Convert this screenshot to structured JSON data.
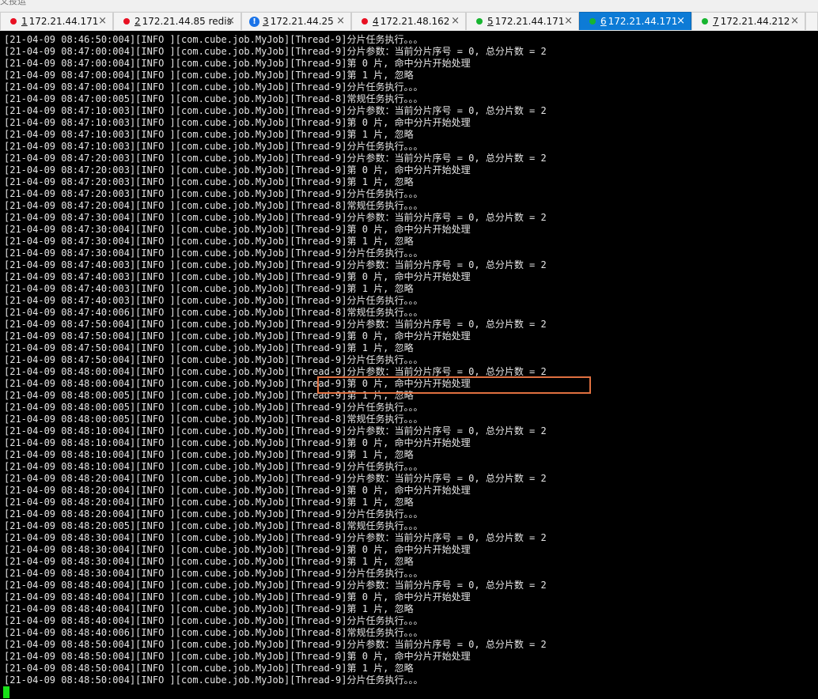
{
  "top_strip": {
    "text": "文投运"
  },
  "tabs": [
    {
      "num": "1",
      "title": "172.21.44.171",
      "status": "red",
      "close": "×"
    },
    {
      "num": "2",
      "title": "172.21.44.85 redis",
      "status": "red",
      "close": "×"
    },
    {
      "num": "3",
      "title": "172.21.44.25",
      "status": "warn",
      "close": "×"
    },
    {
      "num": "4",
      "title": "172.21.48.162",
      "status": "red",
      "close": "×"
    },
    {
      "num": "5",
      "title": "172.21.44.171",
      "status": "green",
      "close": "×"
    },
    {
      "num": "6",
      "title": "172.21.44.171",
      "status": "green",
      "close": "×",
      "active": true
    },
    {
      "num": "7",
      "title": "172.21.44.212",
      "status": "green",
      "close": "×"
    }
  ],
  "log_lines": [
    "[21-04-09 08:46:50:004][INFO ][com.cube.job.MyJob][Thread-9]分片任务执行。。。",
    "[21-04-09 08:47:00:004][INFO ][com.cube.job.MyJob][Thread-9]分片参数：当前分片序号 = 0, 总分片数 = 2",
    "[21-04-09 08:47:00:004][INFO ][com.cube.job.MyJob][Thread-9]第 0 片, 命中分片开始处理",
    "[21-04-09 08:47:00:004][INFO ][com.cube.job.MyJob][Thread-9]第 1 片, 忽略",
    "[21-04-09 08:47:00:004][INFO ][com.cube.job.MyJob][Thread-9]分片任务执行。。。",
    "[21-04-09 08:47:00:005][INFO ][com.cube.job.MyJob][Thread-8]常规任务执行。。。",
    "[21-04-09 08:47:10:003][INFO ][com.cube.job.MyJob][Thread-9]分片参数：当前分片序号 = 0, 总分片数 = 2",
    "[21-04-09 08:47:10:003][INFO ][com.cube.job.MyJob][Thread-9]第 0 片, 命中分片开始处理",
    "[21-04-09 08:47:10:003][INFO ][com.cube.job.MyJob][Thread-9]第 1 片, 忽略",
    "[21-04-09 08:47:10:003][INFO ][com.cube.job.MyJob][Thread-9]分片任务执行。。。",
    "[21-04-09 08:47:20:003][INFO ][com.cube.job.MyJob][Thread-9]分片参数：当前分片序号 = 0, 总分片数 = 2",
    "[21-04-09 08:47:20:003][INFO ][com.cube.job.MyJob][Thread-9]第 0 片, 命中分片开始处理",
    "[21-04-09 08:47:20:003][INFO ][com.cube.job.MyJob][Thread-9]第 1 片, 忽略",
    "[21-04-09 08:47:20:003][INFO ][com.cube.job.MyJob][Thread-9]分片任务执行。。。",
    "[21-04-09 08:47:20:004][INFO ][com.cube.job.MyJob][Thread-8]常规任务执行。。。",
    "[21-04-09 08:47:30:004][INFO ][com.cube.job.MyJob][Thread-9]分片参数：当前分片序号 = 0, 总分片数 = 2",
    "[21-04-09 08:47:30:004][INFO ][com.cube.job.MyJob][Thread-9]第 0 片, 命中分片开始处理",
    "[21-04-09 08:47:30:004][INFO ][com.cube.job.MyJob][Thread-9]第 1 片, 忽略",
    "[21-04-09 08:47:30:004][INFO ][com.cube.job.MyJob][Thread-9]分片任务执行。。。",
    "[21-04-09 08:47:40:003][INFO ][com.cube.job.MyJob][Thread-9]分片参数：当前分片序号 = 0, 总分片数 = 2",
    "[21-04-09 08:47:40:003][INFO ][com.cube.job.MyJob][Thread-9]第 0 片, 命中分片开始处理",
    "[21-04-09 08:47:40:003][INFO ][com.cube.job.MyJob][Thread-9]第 1 片, 忽略",
    "[21-04-09 08:47:40:003][INFO ][com.cube.job.MyJob][Thread-9]分片任务执行。。。",
    "[21-04-09 08:47:40:006][INFO ][com.cube.job.MyJob][Thread-8]常规任务执行。。。",
    "[21-04-09 08:47:50:004][INFO ][com.cube.job.MyJob][Thread-9]分片参数：当前分片序号 = 0, 总分片数 = 2",
    "[21-04-09 08:47:50:004][INFO ][com.cube.job.MyJob][Thread-9]第 0 片, 命中分片开始处理",
    "[21-04-09 08:47:50:004][INFO ][com.cube.job.MyJob][Thread-9]第 1 片, 忽略",
    "[21-04-09 08:47:50:004][INFO ][com.cube.job.MyJob][Thread-9]分片任务执行。。。",
    "[21-04-09 08:48:00:004][INFO ][com.cube.job.MyJob][Thread-9]分片参数：当前分片序号 = 0, 总分片数 = 2",
    "[21-04-09 08:48:00:004][INFO ][com.cube.job.MyJob][Thread-9]第 0 片, 命中分片开始处理",
    "[21-04-09 08:48:00:005][INFO ][com.cube.job.MyJob][Thread-9]第 1 片, 忽略",
    "[21-04-09 08:48:00:005][INFO ][com.cube.job.MyJob][Thread-9]分片任务执行。。。",
    "[21-04-09 08:48:00:005][INFO ][com.cube.job.MyJob][Thread-8]常规任务执行。。。",
    "[21-04-09 08:48:10:004][INFO ][com.cube.job.MyJob][Thread-9]分片参数：当前分片序号 = 0, 总分片数 = 2",
    "[21-04-09 08:48:10:004][INFO ][com.cube.job.MyJob][Thread-9]第 0 片, 命中分片开始处理",
    "[21-04-09 08:48:10:004][INFO ][com.cube.job.MyJob][Thread-9]第 1 片, 忽略",
    "[21-04-09 08:48:10:004][INFO ][com.cube.job.MyJob][Thread-9]分片任务执行。。。",
    "[21-04-09 08:48:20:004][INFO ][com.cube.job.MyJob][Thread-9]分片参数：当前分片序号 = 0, 总分片数 = 2",
    "[21-04-09 08:48:20:004][INFO ][com.cube.job.MyJob][Thread-9]第 0 片, 命中分片开始处理",
    "[21-04-09 08:48:20:004][INFO ][com.cube.job.MyJob][Thread-9]第 1 片, 忽略",
    "[21-04-09 08:48:20:004][INFO ][com.cube.job.MyJob][Thread-9]分片任务执行。。。",
    "[21-04-09 08:48:20:005][INFO ][com.cube.job.MyJob][Thread-8]常规任务执行。。。",
    "[21-04-09 08:48:30:004][INFO ][com.cube.job.MyJob][Thread-9]分片参数：当前分片序号 = 0, 总分片数 = 2",
    "[21-04-09 08:48:30:004][INFO ][com.cube.job.MyJob][Thread-9]第 0 片, 命中分片开始处理",
    "[21-04-09 08:48:30:004][INFO ][com.cube.job.MyJob][Thread-9]第 1 片, 忽略",
    "[21-04-09 08:48:30:004][INFO ][com.cube.job.MyJob][Thread-9]分片任务执行。。。",
    "[21-04-09 08:48:40:004][INFO ][com.cube.job.MyJob][Thread-9]分片参数：当前分片序号 = 0, 总分片数 = 2",
    "[21-04-09 08:48:40:004][INFO ][com.cube.job.MyJob][Thread-9]第 0 片, 命中分片开始处理",
    "[21-04-09 08:48:40:004][INFO ][com.cube.job.MyJob][Thread-9]第 1 片, 忽略",
    "[21-04-09 08:48:40:004][INFO ][com.cube.job.MyJob][Thread-9]分片任务执行。。。",
    "[21-04-09 08:48:40:006][INFO ][com.cube.job.MyJob][Thread-8]常规任务执行。。。",
    "[21-04-09 08:48:50:004][INFO ][com.cube.job.MyJob][Thread-9]分片参数：当前分片序号 = 0, 总分片数 = 2",
    "[21-04-09 08:48:50:004][INFO ][com.cube.job.MyJob][Thread-9]第 0 片, 命中分片开始处理",
    "[21-04-09 08:48:50:004][INFO ][com.cube.job.MyJob][Thread-9]第 1 片, 忽略",
    "[21-04-09 08:48:50:004][INFO ][com.cube.job.MyJob][Thread-9]分片任务执行。。。"
  ],
  "highlight": {
    "line_index": 29,
    "color": "#e07040"
  },
  "colors": {
    "active_tab": "#0d7bd6",
    "status_red": "#e81123",
    "status_green": "#17b530",
    "status_warn": "#1a73e8",
    "cursor": "#18e018"
  }
}
